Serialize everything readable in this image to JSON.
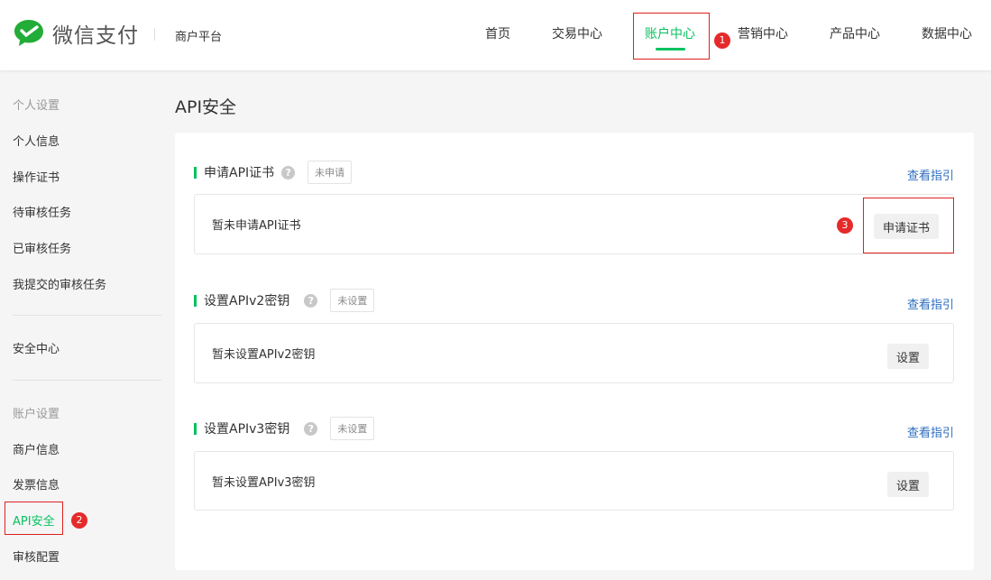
{
  "header": {
    "brand": "微信支付",
    "platform": "商户平台",
    "nav": [
      {
        "label": "首页"
      },
      {
        "label": "交易中心"
      },
      {
        "label": "账户中心",
        "active": true
      },
      {
        "label": "营销中心"
      },
      {
        "label": "产品中心"
      },
      {
        "label": "数据中心"
      }
    ]
  },
  "sidebar": {
    "groups": [
      {
        "title": "个人设置",
        "items": [
          "个人信息",
          "操作证书",
          "待审核任务",
          "已审核任务",
          "我提交的审核任务"
        ]
      },
      {
        "items": [
          "安全中心"
        ]
      },
      {
        "title": "账户设置",
        "items": [
          "商户信息",
          "发票信息",
          "API安全",
          "审核配置"
        ]
      }
    ],
    "active": "API安全"
  },
  "page": {
    "title": "API安全"
  },
  "sections": [
    {
      "title": "申请API证书",
      "tag": "未申请",
      "guide": "查看指引",
      "text": "暂未申请API证书",
      "button": "申请证书"
    },
    {
      "title": "设置APIv2密钥",
      "tag": "未设置",
      "guide": "查看指引",
      "text": "暂未设置APIv2密钥",
      "button": "设置"
    },
    {
      "title": "设置APIv3密钥",
      "tag": "未设置",
      "guide": "查看指引",
      "text": "暂未设置APIv3密钥",
      "button": "设置"
    }
  ],
  "annotations": [
    "1",
    "2",
    "3"
  ],
  "help_icon": "?",
  "colors": {
    "accent": "#07c160",
    "annotation": "#e52a2a",
    "link": "#2d6dbf"
  }
}
